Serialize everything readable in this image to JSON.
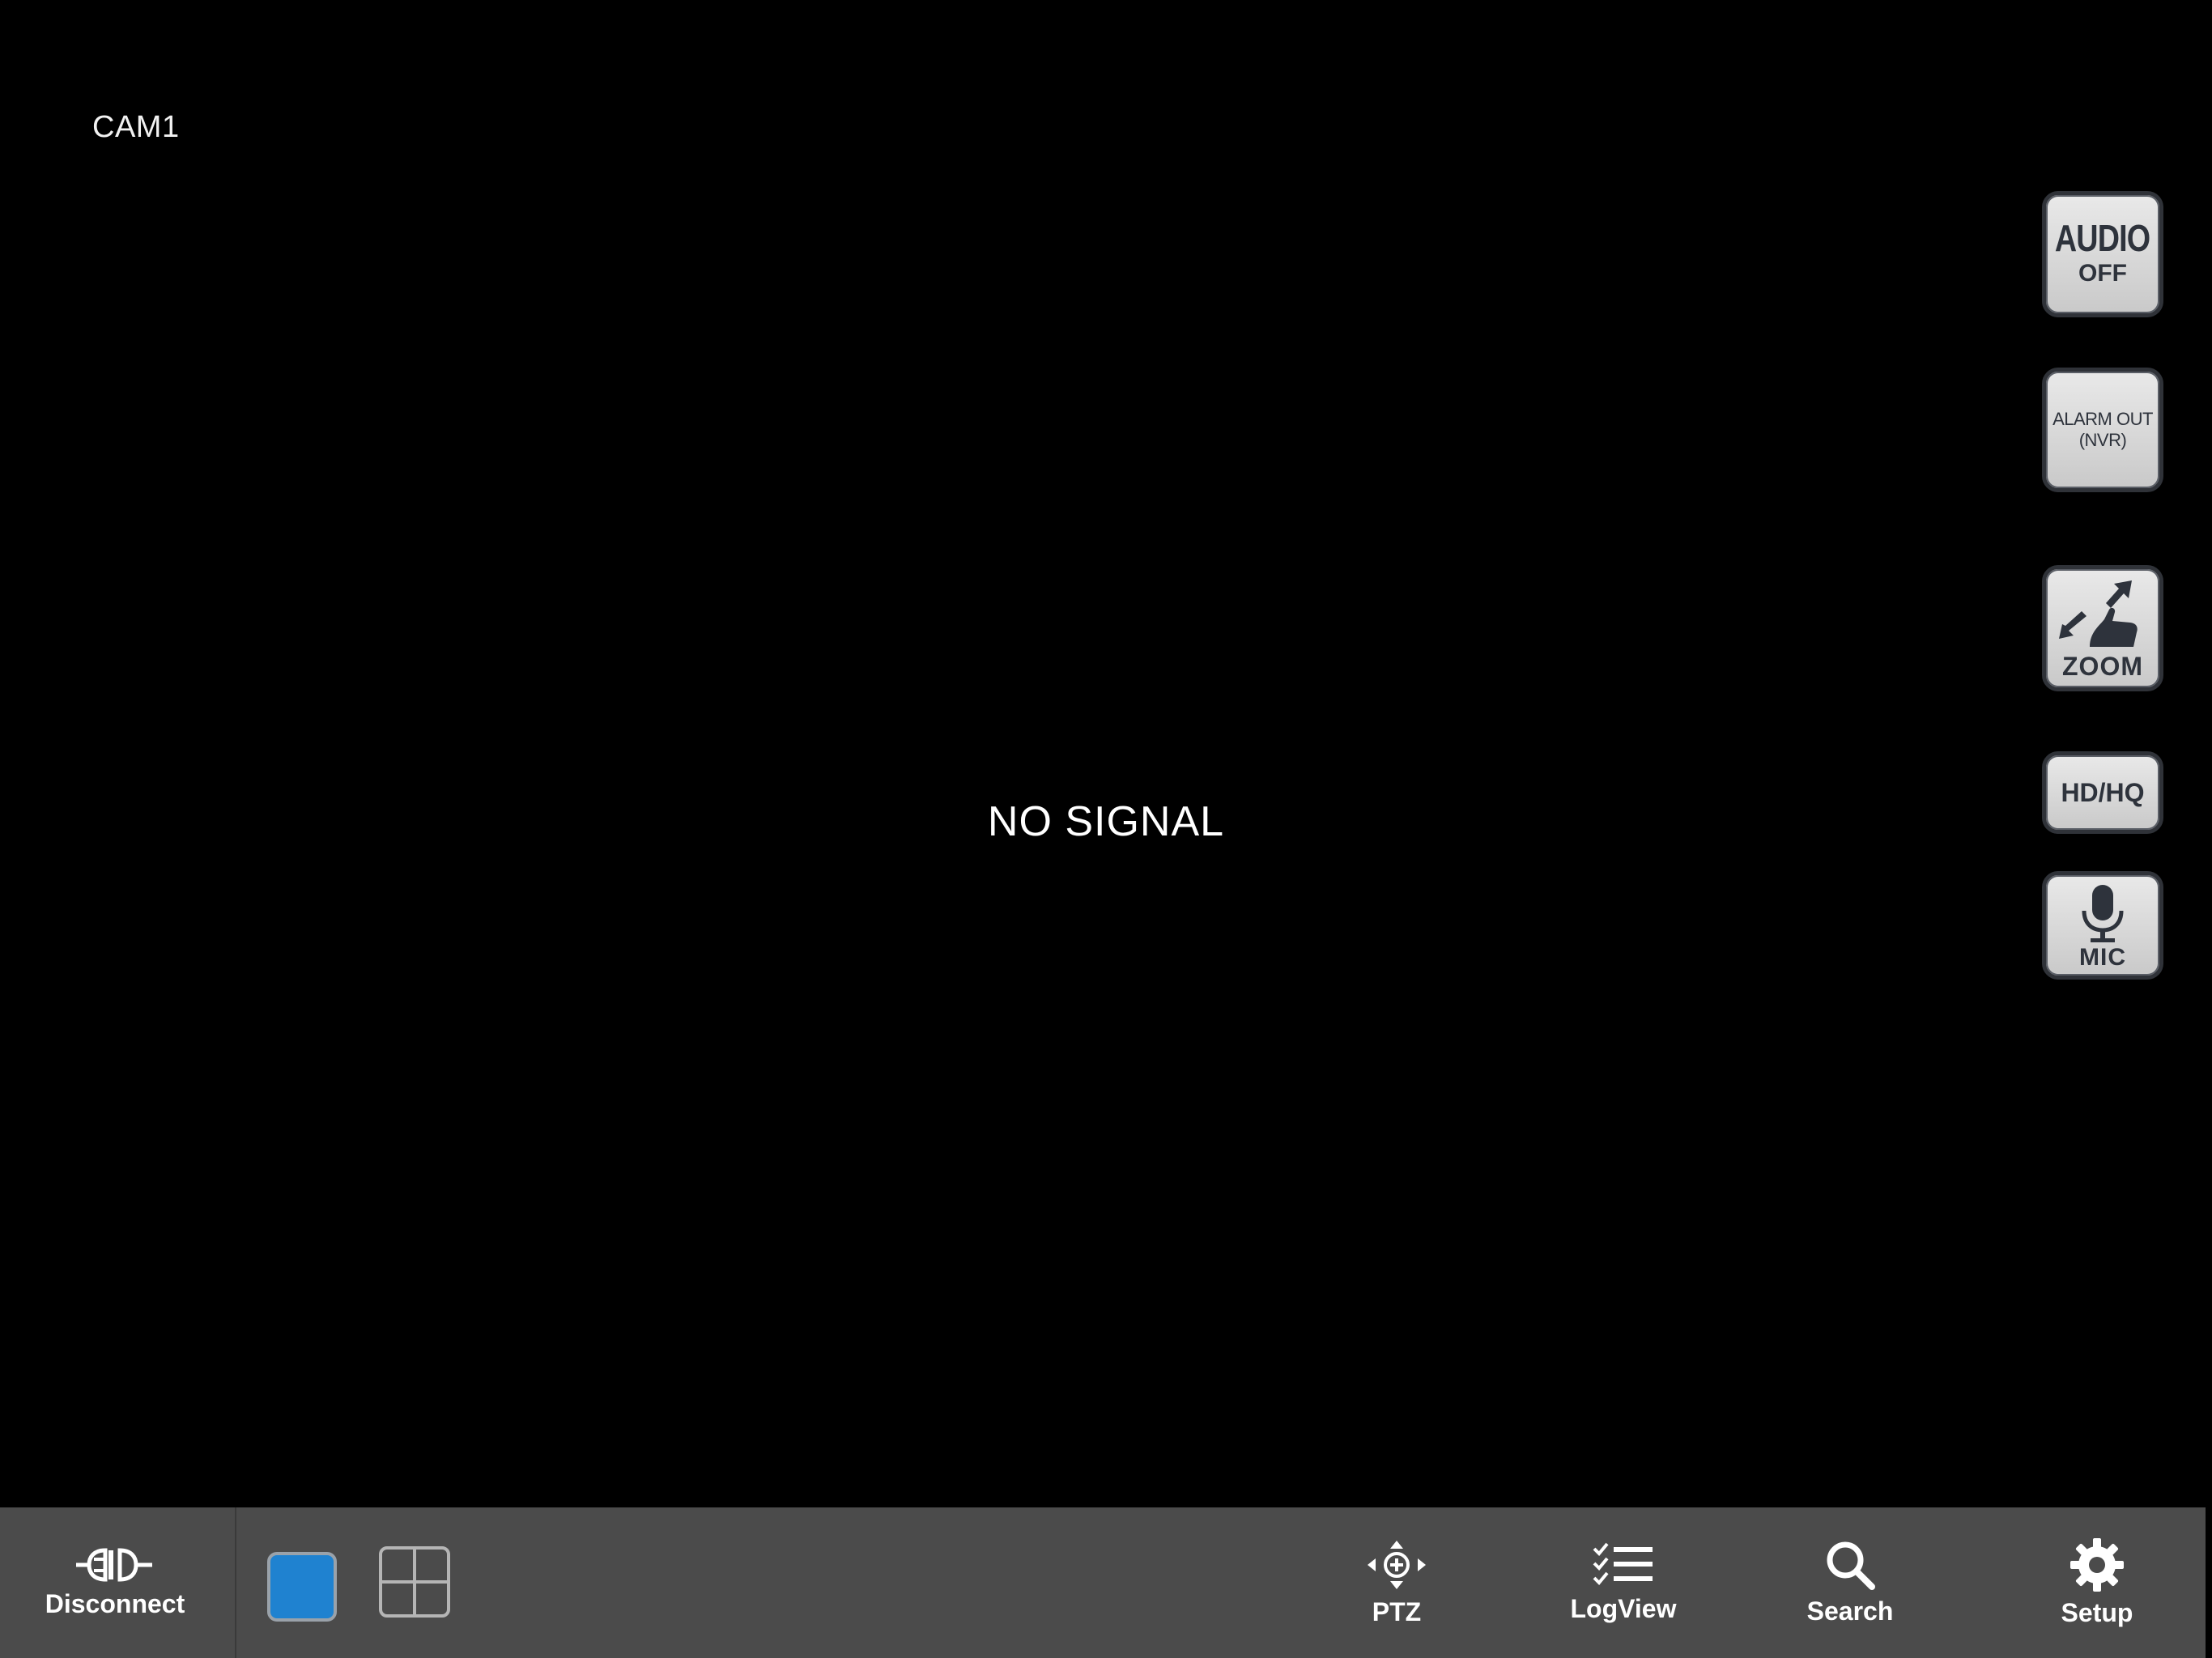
{
  "camera": {
    "label": "CAM1",
    "status": "NO SIGNAL"
  },
  "side_controls": {
    "audio": {
      "line1": "AUDIO",
      "line2": "OFF"
    },
    "alarm": {
      "line1": "ALARM OUT",
      "line2": "(NVR)"
    },
    "zoom": {
      "label": "ZOOM",
      "icon": "zoom-gesture-icon"
    },
    "quality": {
      "label": "HD/HQ"
    },
    "mic": {
      "label": "MIC",
      "icon": "microphone-icon"
    }
  },
  "toolbar": {
    "disconnect": {
      "label": "Disconnect",
      "icon": "plug-icon"
    },
    "layouts": [
      {
        "name": "single",
        "selected": true
      },
      {
        "name": "quad",
        "selected": false
      }
    ],
    "ptz": {
      "label": "PTZ",
      "icon": "move-arrows-icon"
    },
    "logview": {
      "label": "LogView",
      "icon": "checklist-icon"
    },
    "search": {
      "label": "Search",
      "icon": "search-icon"
    },
    "setup": {
      "label": "Setup",
      "icon": "gear-icon"
    }
  },
  "colors": {
    "background": "#000000",
    "toolbar": "#4b4b4b",
    "selected_layout": "#1f82d0",
    "button_face": "#d6d6d6",
    "button_text": "#2e333c"
  }
}
